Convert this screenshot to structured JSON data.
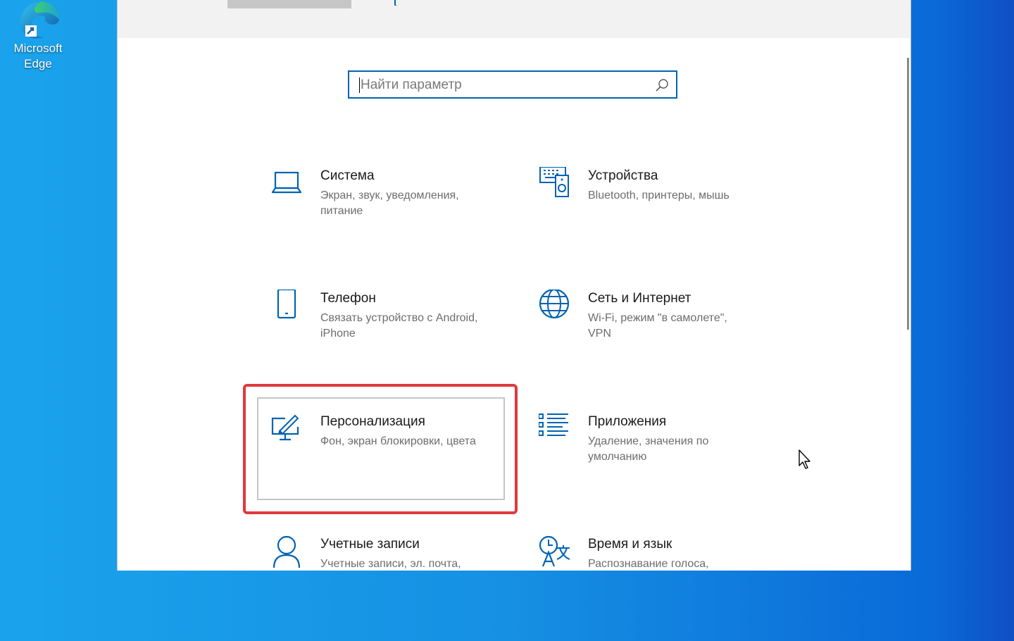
{
  "desktop": {
    "edge_label_line1": "Microsoft",
    "edge_label_line2": "Edge"
  },
  "search": {
    "placeholder": "Найти параметр",
    "value": ""
  },
  "categories": [
    {
      "title": "Система",
      "subtitle": "Экран, звук, уведомления, питание",
      "icon": "laptop-icon"
    },
    {
      "title": "Устройства",
      "subtitle": "Bluetooth, принтеры, мышь",
      "icon": "devices-icon"
    },
    {
      "title": "Телефон",
      "subtitle": "Связать устройство с Android, iPhone",
      "icon": "phone-icon"
    },
    {
      "title": "Сеть и Интернет",
      "subtitle": "Wi-Fi, режим \"в самолете\", VPN",
      "icon": "globe-icon"
    },
    {
      "title": "Персонализация",
      "subtitle": "Фон, экран блокировки, цвета",
      "icon": "personalization-icon"
    },
    {
      "title": "Приложения",
      "subtitle": "Удаление, значения по умолчанию",
      "icon": "apps-list-icon"
    },
    {
      "title": "Учетные записи",
      "subtitle": "Учетные записи, эл. почта,",
      "icon": "person-icon"
    },
    {
      "title": "Время и язык",
      "subtitle": "Распознавание голоса,",
      "icon": "time-language-icon"
    }
  ],
  "colors": {
    "accent": "#0063b1",
    "highlight": "#e0393e",
    "desktop": "#1690e3"
  }
}
